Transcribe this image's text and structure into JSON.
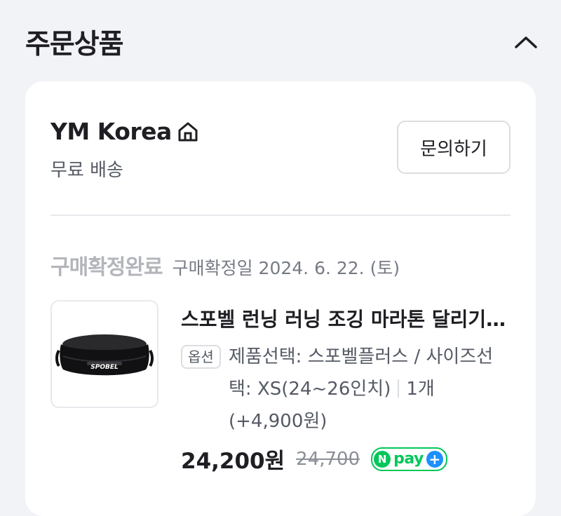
{
  "section": {
    "title": "주문상품",
    "collapse_icon": "chevron-up-icon"
  },
  "order": {
    "seller_name": "YM Korea",
    "seller_icon": "home-icon",
    "shipping": "무료 배송",
    "inquiry_button": "문의하기",
    "status_label": "구매확정완료",
    "status_date": "구매확정일 2024. 6. 22. (토)",
    "product": {
      "title": "스포벨 런닝 러닝 조깅 마라톤 달리기 허리벨트",
      "option_badge": "옵션",
      "option_text": "제품선택: 스포벨플러스 / 사이즈선택: XS(24~26인치)",
      "quantity_text": "1개 (+4,900원)",
      "image_logo_text": "SPOBEL",
      "price": "24,200원",
      "original_price": "24,700",
      "npay": {
        "n": "N",
        "label": "pay",
        "plus": "+"
      }
    }
  },
  "colors": {
    "background": "#f2f3f6",
    "card": "#ffffff",
    "text_primary": "#1e1e23",
    "status_muted": "#b3b5bb",
    "npay_green": "#03c75a",
    "npay_plus_blue": "#1e90ff"
  }
}
